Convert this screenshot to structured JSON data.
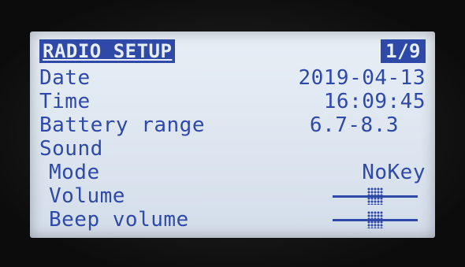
{
  "header": {
    "title": "RADIO SETUP",
    "page": "1/9"
  },
  "rows": [
    {
      "label": "Date",
      "value": "2019-04-13"
    },
    {
      "label": "Time",
      "value": "16:09:45"
    },
    {
      "label": "Battery range",
      "value": "6.7-8.3"
    },
    {
      "label": "Sound",
      "value": ""
    },
    {
      "label": "Mode",
      "value": "NoKey"
    },
    {
      "label": "Volume",
      "level": 0.5
    },
    {
      "label": "Beep volume",
      "level": 0.5
    }
  ],
  "colors": {
    "text": "#2f49a8",
    "lcd_background": "#e2eaf3"
  }
}
